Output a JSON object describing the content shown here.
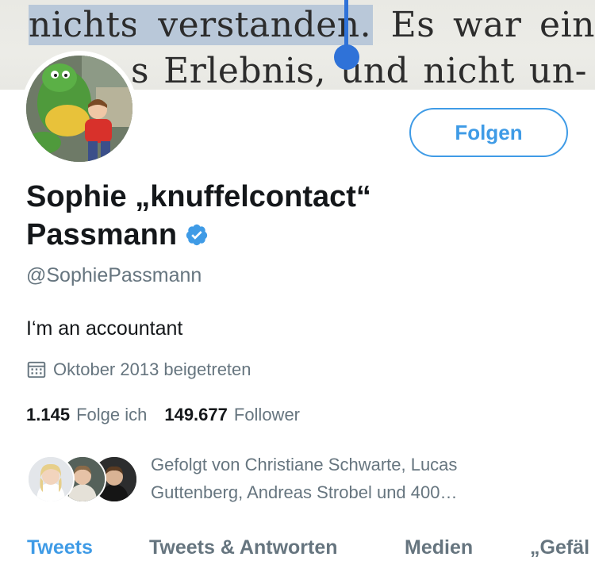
{
  "banner": {
    "line1": [
      "nichts",
      "verstanden",
      ". Es",
      "war",
      "ein"
    ],
    "line1_words": [
      "nichts",
      "verstanden.",
      "Es",
      "war",
      "ein"
    ],
    "line2_words": [
      "s",
      "Erlebnis,",
      "und",
      "nicht",
      "un-"
    ],
    "selection_color": "#b9c8d9",
    "caret_color": "#2f72d8"
  },
  "profile": {
    "display_name_line1": "Sophie „knuffelcontact“",
    "display_name_line2": "Passmann",
    "handle": "@SophiePassmann",
    "bio": "I‘m an accountant",
    "joined": "Oktober 2013 beigetreten",
    "verified_icon": "verified-badge-icon",
    "follow_label": "Folgen",
    "accent_color": "#3f9be6"
  },
  "stats": {
    "following_count": "1.145",
    "following_label": "Folge ich",
    "followers_count": "149.677",
    "followers_label": "Follower"
  },
  "followed_by": {
    "line1": "Gefolgt von Christiane Schwarte, Lucas",
    "line2": "Guttenberg, Andreas Strobel und 400…"
  },
  "tabs": [
    {
      "label": "Tweets",
      "active": true
    },
    {
      "label": "Tweets & Antworten",
      "active": false
    },
    {
      "label": "Medien",
      "active": false
    },
    {
      "label": "„Gefäl",
      "active": false
    }
  ]
}
